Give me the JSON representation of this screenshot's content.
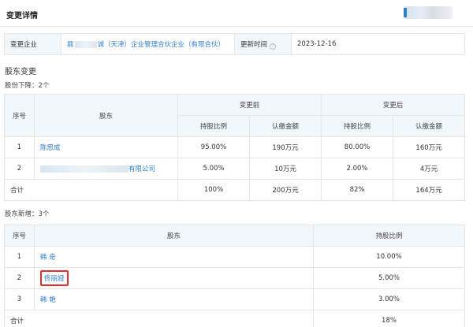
{
  "header": {
    "title": "变更详情"
  },
  "info": {
    "company_label": "变更企业",
    "company_prefix": "鼎",
    "company_name": "诚（天津）企业管理合伙企业（有限合伙）",
    "update_label": "更新时间",
    "update_value": "2023-12-16"
  },
  "shareholder_change": {
    "title": "股东变更",
    "decrease_label": "股份下降：2个",
    "headers": {
      "seq": "序号",
      "holder": "股东",
      "before": "变更前",
      "after": "变更后",
      "ratio": "持股比例",
      "amount": "认缴金额"
    },
    "rows": [
      {
        "seq": "1",
        "name": "陈思成",
        "before_ratio": "95.00%",
        "before_amount": "190万元",
        "after_ratio": "80.00%",
        "after_amount": "160万元"
      },
      {
        "seq": "2",
        "name": "有限公司",
        "before_ratio": "5.00%",
        "before_amount": "10万元",
        "after_ratio": "2.00%",
        "after_amount": "4万元"
      }
    ],
    "total": {
      "label": "合计",
      "before_ratio": "100%",
      "before_amount": "200万元",
      "after_ratio": "82%",
      "after_amount": "164万元"
    }
  },
  "new_shareholders": {
    "title": "股东新增：3个",
    "headers": {
      "seq": "序号",
      "holder": "股东",
      "ratio": "持股比例"
    },
    "rows": [
      {
        "seq": "1",
        "name": "韩 奇",
        "ratio": "10.00%"
      },
      {
        "seq": "2",
        "name": "佟丽娅",
        "ratio": "5.00%"
      },
      {
        "seq": "3",
        "name": "韩 艳",
        "ratio": "3.00%"
      }
    ],
    "total": {
      "label": "合计",
      "ratio": "18%"
    }
  },
  "colors": {
    "link": "#2f7fc9",
    "header_bg": "#f2f7fc",
    "highlight_border": "#e02e2e"
  }
}
